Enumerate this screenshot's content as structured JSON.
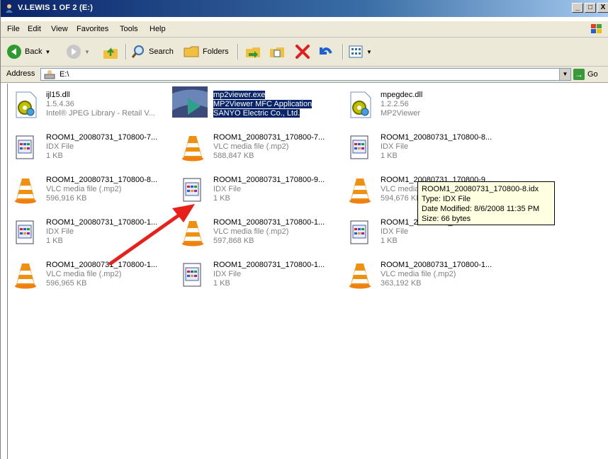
{
  "window": {
    "title": "V.LEWIS 1 OF 2 (E:)",
    "min_glyph": "_",
    "max_glyph": "□",
    "close_glyph": "X"
  },
  "menu": [
    {
      "label": "File"
    },
    {
      "label": "Edit"
    },
    {
      "label": "View"
    },
    {
      "label": "Favorites"
    },
    {
      "label": "Tools"
    },
    {
      "label": "Help"
    }
  ],
  "toolbar": {
    "back_label": "Back",
    "search_label": "Search",
    "folders_label": "Folders"
  },
  "address": {
    "label": "Address",
    "value": "E:\\",
    "go_label": "Go"
  },
  "files": [
    {
      "name": "ijl15.dll",
      "line2": "1.5.4.36",
      "line3": "Intel® JPEG Library - Retail V...",
      "icon": "dll-gear-icon"
    },
    {
      "name": "mp2viewer.exe",
      "line2": "MP2Viewer MFC Application",
      "line3": "SANYO Electric Co., Ltd.",
      "icon": "mp2viewer-app-icon",
      "selected": true
    },
    {
      "name": "mpegdec.dll",
      "line2": "1.2.2.56",
      "line3": "MP2Viewer",
      "icon": "dll-gear-icon"
    },
    {
      "name": "ROOM1_20080731_170800-7...",
      "line2": "IDX File",
      "line3": "1 KB",
      "icon": "idx-file-icon"
    },
    {
      "name": "ROOM1_20080731_170800-7...",
      "line2": "VLC media file (.mp2)",
      "line3": "588,847 KB",
      "icon": "vlc-cone-icon"
    },
    {
      "name": "ROOM1_20080731_170800-8...",
      "line2": "IDX File",
      "line3": "1 KB",
      "icon": "idx-file-icon"
    },
    {
      "name": "ROOM1_20080731_170800-8...",
      "line2": "VLC media file (.mp2)",
      "line3": "596,916 KB",
      "icon": "vlc-cone-icon"
    },
    {
      "name": "ROOM1_20080731_170800-9...",
      "line2": "IDX File",
      "line3": "1 KB",
      "icon": "idx-file-icon"
    },
    {
      "name": "ROOM1_20080731_170800-9...",
      "line2": "VLC media file (.mp2)",
      "line3": "594,676 KB",
      "icon": "vlc-cone-icon"
    },
    {
      "name": "ROOM1_20080731_170800-1...",
      "line2": "IDX File",
      "line3": "1 KB",
      "icon": "idx-file-icon"
    },
    {
      "name": "ROOM1_20080731_170800-1...",
      "line2": "VLC media file (.mp2)",
      "line3": "597,868 KB",
      "icon": "vlc-cone-icon"
    },
    {
      "name": "ROOM1_20080731_170800-1...",
      "line2": "IDX File",
      "line3": "1 KB",
      "icon": "idx-file-icon"
    },
    {
      "name": "ROOM1_20080731_170800-1...",
      "line2": "VLC media file (.mp2)",
      "line3": "596,965 KB",
      "icon": "vlc-cone-icon"
    },
    {
      "name": "ROOM1_20080731_170800-1...",
      "line2": "IDX File",
      "line3": "1 KB",
      "icon": "idx-file-icon"
    },
    {
      "name": "ROOM1_20080731_170800-1...",
      "line2": "VLC media file (.mp2)",
      "line3": "363,192 KB",
      "icon": "vlc-cone-icon"
    }
  ],
  "tooltip": {
    "line1": "ROOM1_20080731_170800-8.idx",
    "line2": "Type: IDX File",
    "line3": "Date Modified: 8/6/2008 11:35 PM",
    "line4": "Size: 66 bytes"
  },
  "colors": {
    "selection": "#0a246a",
    "annotation_arrow": "#e8201a",
    "tooltip_bg": "#ffffe1"
  }
}
